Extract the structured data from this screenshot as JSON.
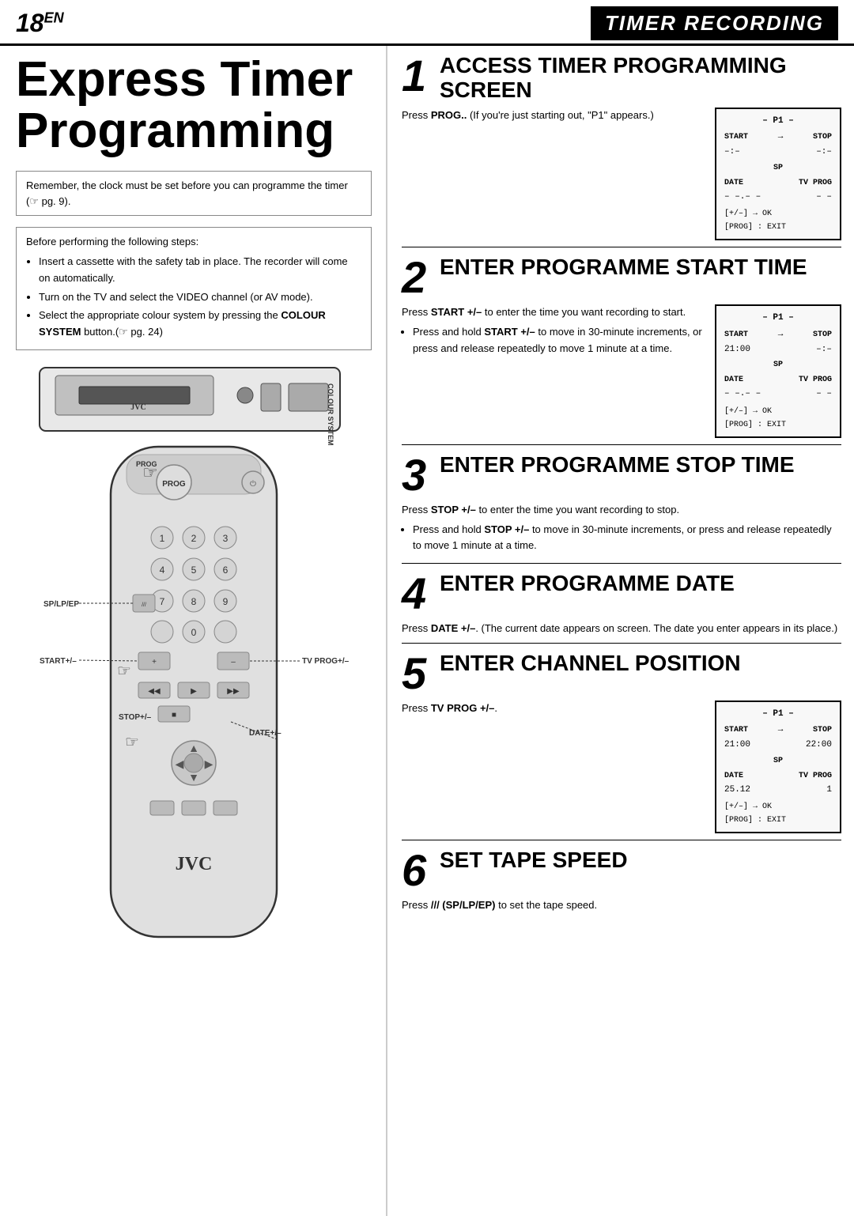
{
  "header": {
    "page_number": "18",
    "page_suffix": "EN",
    "section_label": "TIMER RECORDING"
  },
  "left": {
    "main_title": "Express Timer Programming",
    "note_text": "Remember, the clock must be set before you can programme the timer (☞ pg. 9).",
    "steps_heading": "Before performing the following steps:",
    "steps": [
      "Insert a cassette with the safety tab in place. The recorder will come on automatically.",
      "Turn on the TV and select the VIDEO channel (or AV mode).",
      "Select the appropriate colour system by pressing the COLOUR SYSTEM button.(☞ pg. 24)"
    ]
  },
  "right": {
    "sections": [
      {
        "number": "1",
        "title": "ACCESS TIMER PROGRAMMING SCREEN",
        "text": "Press PROG.. (If you're just starting out, \"P1\" appears.)",
        "has_lcd": true,
        "lcd": {
          "title": "– P1 –",
          "start_label": "START",
          "start_val": "–:–",
          "stop_label": "STOP",
          "stop_val": "–:–",
          "sp": "SP",
          "date_label": "DATE",
          "date_val": "– –.– –",
          "tvprog_label": "TV PROG",
          "tvprog_val": "– –",
          "bottom1": "[+/–] → OK",
          "bottom2": "[PROG] : EXIT"
        },
        "bullets": []
      },
      {
        "number": "2",
        "title": "ENTER PROGRAMME START TIME",
        "text": "Press START +/– to enter the time you want recording to start.",
        "has_lcd": true,
        "lcd": {
          "title": "– P1 –",
          "start_label": "START",
          "start_val": "21:00",
          "stop_label": "STOP",
          "stop_val": "–:–",
          "sp": "SP",
          "date_label": "DATE",
          "date_val": "– –.– –",
          "tvprog_label": "TV PROG",
          "tvprog_val": "– –",
          "bottom1": "[+/–] → OK",
          "bottom2": "[PROG] : EXIT"
        },
        "bullets": [
          "Press and hold START +/– to move in 30-minute increments, or press and release repeatedly to move 1 minute at a time."
        ]
      },
      {
        "number": "3",
        "title": "ENTER PROGRAMME STOP TIME",
        "text": "Press STOP +/– to enter the time you want recording to stop.",
        "has_lcd": false,
        "bullets": [
          "Press and hold STOP +/– to move in 30-minute increments, or press and release repeatedly to move 1 minute at a time."
        ]
      },
      {
        "number": "4",
        "title": "ENTER PROGRAMME DATE",
        "text": "Press DATE +/–. (The current date appears on screen. The date you enter appears in its place.)",
        "has_lcd": false,
        "bullets": []
      },
      {
        "number": "5",
        "title": "ENTER CHANNEL POSITION",
        "text": "Press TV PROG +/–.",
        "has_lcd": true,
        "lcd": {
          "title": "– P1 –",
          "start_label": "START",
          "start_val": "21:00",
          "stop_label": "STOP",
          "stop_val": "22:00",
          "sp": "SP",
          "date_label": "DATE",
          "date_val": "25.12",
          "tvprog_label": "TV PROG",
          "tvprog_val": "1",
          "bottom1": "[+/–] → OK",
          "bottom2": "[PROG] : EXIT"
        },
        "bullets": []
      },
      {
        "number": "6",
        "title": "SET TAPE SPEED",
        "text": "Press /// (SP/LP/EP) to set the tape speed.",
        "has_lcd": false,
        "bullets": []
      }
    ]
  },
  "labels": {
    "sp_lp_ep": "SP/LP/EP",
    "start_plus": "START+/–",
    "stop_plus": "STOP+/–",
    "date_plus": "DATE+/–",
    "tv_prog": "TV PROG+/–",
    "prog": "PROG",
    "colour_system": "COLOUR SYSTEM",
    "jvc": "JVC"
  }
}
